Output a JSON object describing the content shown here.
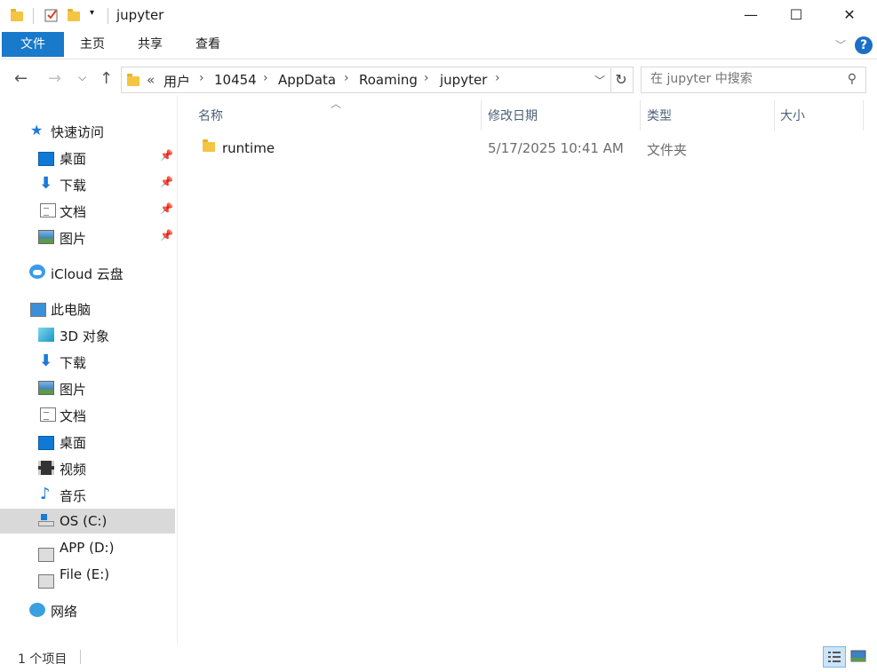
{
  "window": {
    "title": "jupyter",
    "minimize": "—",
    "maximize": "☐",
    "close": "✕"
  },
  "ribbon": {
    "tabs": [
      "文件",
      "主页",
      "共享",
      "查看"
    ],
    "help": "?"
  },
  "address": {
    "overflow": "«",
    "crumbs": [
      "用户",
      "10454",
      "AppData",
      "Roaming",
      "jupyter"
    ],
    "separator": "›"
  },
  "search": {
    "placeholder": "在 jupyter 中搜索"
  },
  "nav": {
    "quick_access": "快速访问",
    "quick_items": [
      "桌面",
      "下载",
      "文档",
      "图片"
    ],
    "icloud": "iCloud 云盘",
    "this_pc": "此电脑",
    "pc_items": [
      "3D 对象",
      "下载",
      "图片",
      "文档",
      "桌面",
      "视频",
      "音乐",
      "OS (C:)",
      "APP (D:)",
      "File (E:)"
    ],
    "network": "网络"
  },
  "columns": {
    "name": "名称",
    "date": "修改日期",
    "type": "类型",
    "size": "大小"
  },
  "files": [
    {
      "name": "runtime",
      "date": "5/17/2025 10:41 AM",
      "type": "文件夹",
      "size": ""
    }
  ],
  "status": {
    "count": "1 个项目"
  },
  "colors": {
    "accent": "#1979ca",
    "selection": "#d9d9d9",
    "folder": "#f4c542"
  }
}
